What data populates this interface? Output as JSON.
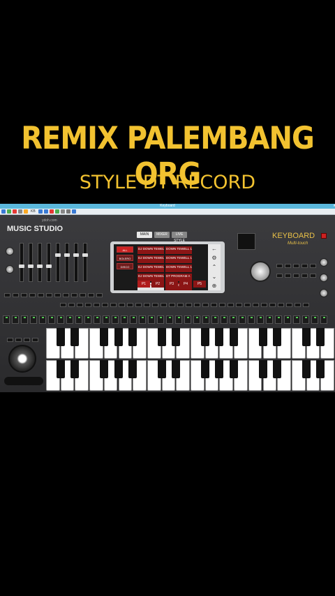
{
  "overlay": {
    "title": "REMIX PALEMBANG ORG",
    "subtitle": "STYLE DT RECORD"
  },
  "window": {
    "title": "Keyboard",
    "controls": [
      "—",
      "□",
      "✕"
    ],
    "toolbar_text": "KB"
  },
  "panel": {
    "brand_small": "ydoh.com",
    "brand": "MUSIC STUDIO",
    "keyboard_title": "KEYBOARD",
    "keyboard_sub": "Multi-touch",
    "tabs": [
      "MAIN",
      "MIXER",
      "LIVE STYLE"
    ],
    "categories": [
      "ALL",
      "BOLERO",
      "DISCO"
    ],
    "styles": [
      "DJ DOWN TEWELL 1",
      "DOWN TEWELL 1",
      "DJ DOWN TEWELL 1",
      "DOWN TEWELL 1",
      "DJ DOWN TEWELL 1",
      "DOWN TEWELL 1",
      "DJ DOWN TEWELL 1",
      "DT PROGRAM A",
      "DOWN TEWELL 1",
      "DT PROGRAM A"
    ],
    "pages": [
      "P1",
      "P2",
      "P3",
      "P4",
      "P5"
    ]
  },
  "colors": {
    "overlay_text": "#f2c230",
    "screen_red": "#8b1515",
    "keyboard_gold": "#e8c048",
    "titlebar": "#5bb8dc"
  }
}
